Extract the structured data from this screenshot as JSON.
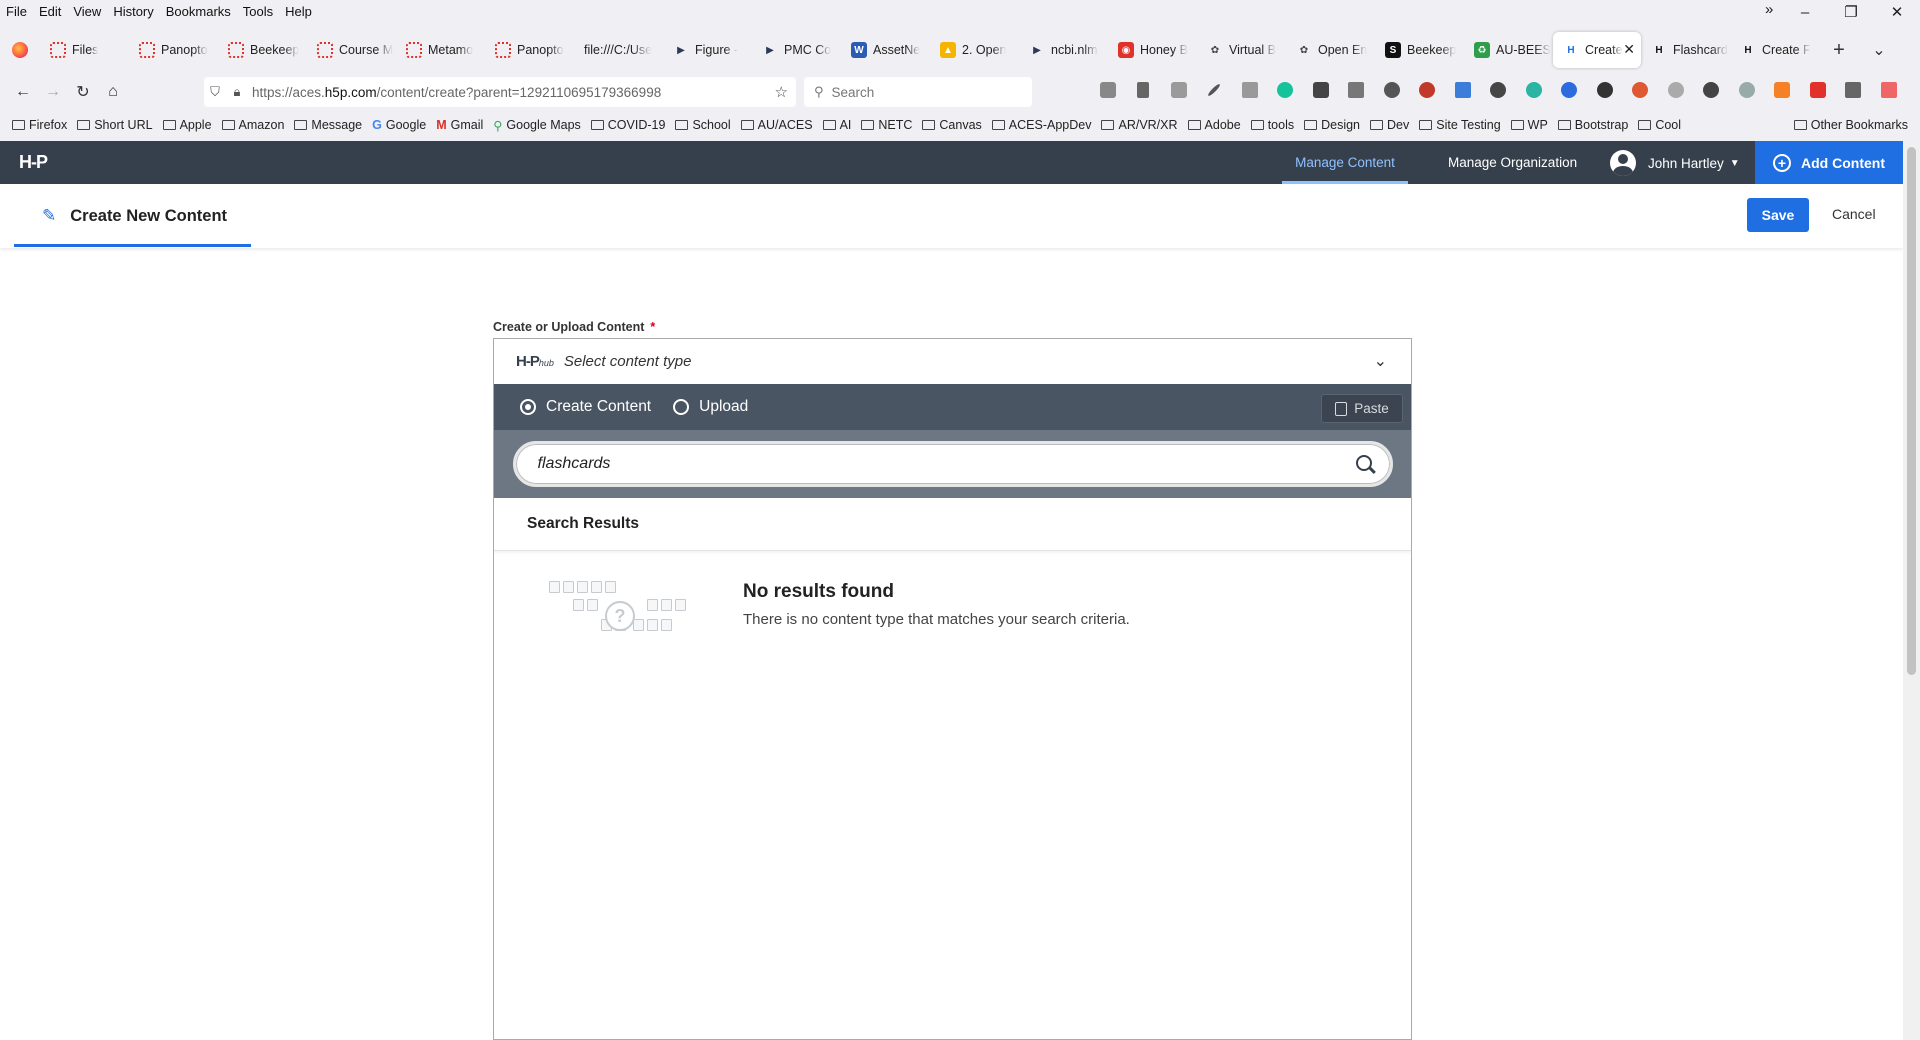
{
  "browser": {
    "menu": [
      "File",
      "Edit",
      "View",
      "History",
      "Bookmarks",
      "Tools",
      "Help"
    ],
    "window_controls": [
      "–",
      "❐",
      "✕"
    ],
    "tabs": [
      {
        "label": "Files",
        "icon": "panopto-icon",
        "color": "#e0322a"
      },
      {
        "label": "Panopto",
        "icon": "panopto-icon",
        "color": "#e0322a"
      },
      {
        "label": "Beekeep",
        "icon": "panopto-icon",
        "color": "#e0322a"
      },
      {
        "label": "Course M",
        "icon": "panopto-icon",
        "color": "#e0322a"
      },
      {
        "label": "Metamo",
        "icon": "panopto-icon",
        "color": "#e0322a"
      },
      {
        "label": "Panopto",
        "icon": "panopto-icon",
        "color": "#e0322a"
      },
      {
        "label": "file:///C:/Use",
        "icon": "none",
        "color": "#888888"
      },
      {
        "label": "Figure -",
        "icon": "arrow-icon",
        "color": "#2b3a55"
      },
      {
        "label": "PMC Co",
        "icon": "arrow-icon",
        "color": "#2b3a55"
      },
      {
        "label": "AssetNe",
        "icon": "word-icon",
        "color": "#2b5cb3"
      },
      {
        "label": "2. Open",
        "icon": "drive-icon",
        "color": "#f4b400"
      },
      {
        "label": "ncbi.nlm",
        "icon": "arrow-icon",
        "color": "#2b3a55"
      },
      {
        "label": "Honey B",
        "icon": "red-icon",
        "color": "#e0322a"
      },
      {
        "label": "Virtual B",
        "icon": "gear-icon",
        "color": "#444444"
      },
      {
        "label": "Open En",
        "icon": "gear-icon",
        "color": "#444444"
      },
      {
        "label": "Beekeep",
        "icon": "s-icon",
        "color": "#111111"
      },
      {
        "label": "AU-BEES",
        "icon": "recycle-icon",
        "color": "#2e9e4a"
      },
      {
        "label": "Create",
        "icon": "h5p-tab-icon",
        "color": "#1f6fe3",
        "active": true
      },
      {
        "label": "Flashcard",
        "icon": "h5p-tab-icon",
        "color": "#111111"
      },
      {
        "label": "Create F",
        "icon": "h5p-tab-icon",
        "color": "#111111"
      }
    ],
    "url_prefix": "https://aces.",
    "url_host": "h5p.com",
    "url_path": "/content/create?parent=1292110695179366998",
    "search_placeholder": "Search",
    "bookmarks": [
      {
        "label": "Firefox",
        "type": "folder"
      },
      {
        "label": "Short URL",
        "type": "folder"
      },
      {
        "label": "Apple",
        "type": "folder"
      },
      {
        "label": "Amazon",
        "type": "folder"
      },
      {
        "label": "Message",
        "type": "folder"
      },
      {
        "label": "Google",
        "type": "google"
      },
      {
        "label": "Gmail",
        "type": "gmail"
      },
      {
        "label": "Google Maps",
        "type": "maps"
      },
      {
        "label": "COVID-19",
        "type": "folder"
      },
      {
        "label": "School",
        "type": "folder"
      },
      {
        "label": "AU/ACES",
        "type": "folder"
      },
      {
        "label": "AI",
        "type": "folder"
      },
      {
        "label": "NETC",
        "type": "folder"
      },
      {
        "label": "Canvas",
        "type": "folder"
      },
      {
        "label": "ACES-AppDev",
        "type": "folder"
      },
      {
        "label": "AR/VR/XR",
        "type": "folder"
      },
      {
        "label": "Adobe",
        "type": "folder"
      },
      {
        "label": "tools",
        "type": "folder"
      },
      {
        "label": "Design",
        "type": "folder"
      },
      {
        "label": "Dev",
        "type": "folder"
      },
      {
        "label": "Site Testing",
        "type": "folder"
      },
      {
        "label": "WP",
        "type": "folder"
      },
      {
        "label": "Bootstrap",
        "type": "folder"
      },
      {
        "label": "Cool",
        "type": "folder"
      }
    ],
    "bookmarks_more": "»",
    "other_bookmarks": "Other Bookmarks"
  },
  "h5p": {
    "logo": "H-P",
    "nav": {
      "manage_content": "Manage Content",
      "manage_org": "Manage Organization"
    },
    "user_name": "John Hartley",
    "add_content": "Add Content",
    "page_title": "Create New Content",
    "save": "Save",
    "cancel": "Cancel",
    "field_label": "Create or Upload Content",
    "required_mark": "*",
    "hub_logo": "H-P",
    "hub_logo_small": "hub",
    "select_placeholder": "Select content type",
    "modes": {
      "create": "Create Content",
      "upload": "Upload",
      "selected": "create"
    },
    "paste": "Paste",
    "search_value": "flashcards",
    "results_heading": "Search Results",
    "no_results_title": "No results found",
    "no_results_sub": "There is no content type that matches your search criteria.",
    "accent": "#1f6fe3",
    "header_bg": "#36404c"
  }
}
